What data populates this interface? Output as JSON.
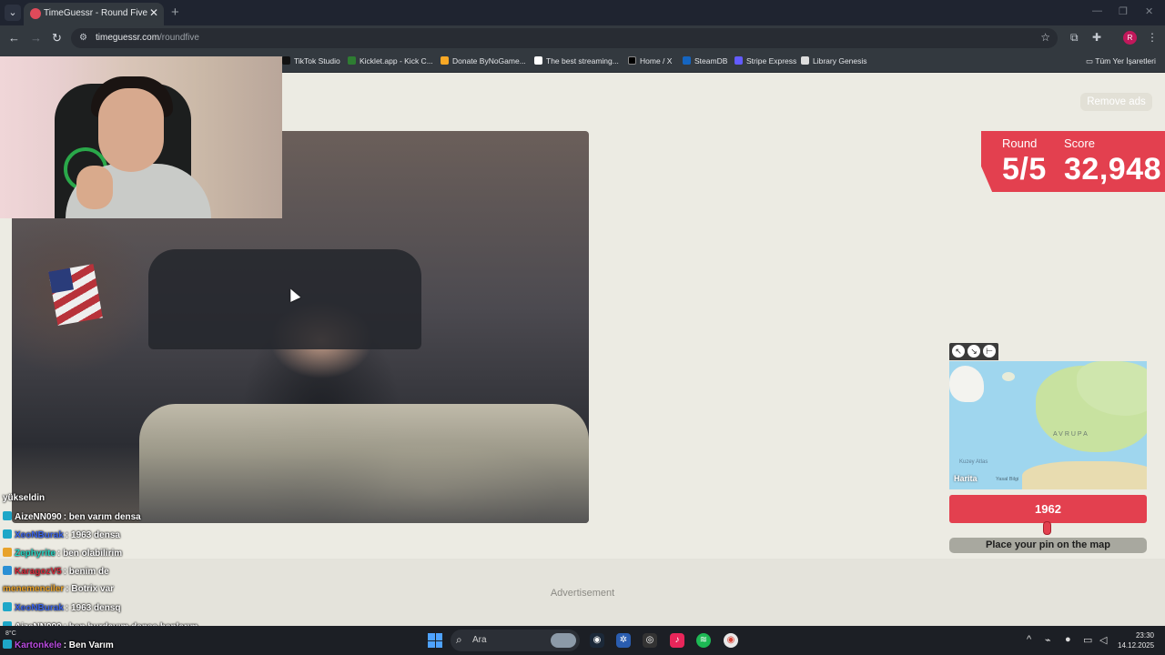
{
  "browser": {
    "tab_title": "TimeGuessr - Round Five",
    "tab_close": "✕",
    "new_tab": "+",
    "url_host": "timeguessr.com",
    "url_path": "/roundfive",
    "profile_initial": "R",
    "bookmarks": [
      {
        "label": "TikTok Studio",
        "color": "#111111"
      },
      {
        "label": "Kicklet.app - Kick C...",
        "color": "#2e7d32"
      },
      {
        "label": "Donate ByNoGame...",
        "color": "#f9a825"
      },
      {
        "label": "The best streaming...",
        "color": "#ffffff"
      },
      {
        "label": "Home / X",
        "color": "#000000"
      },
      {
        "label": "SteamDB",
        "color": "#1565c0"
      },
      {
        "label": "Stripe Express",
        "color": "#635bff"
      },
      {
        "label": "Library Genesis",
        "color": "#dddddd"
      }
    ],
    "all_bookmarks": "Tüm Yer İşaretleri"
  },
  "page": {
    "remove_ads": "Remove ads",
    "round_label": "Round",
    "round_value": "5/5",
    "score_label": "Score",
    "score_value": "32,948",
    "map_region": "AVRUPA",
    "map_sea": "Kuzey Atlas",
    "map_brand": "Harita",
    "map_legal": "Yasal Bilgi",
    "year": "1962",
    "place_pin": "Place your pin on the map",
    "advertisement": "Advertisement",
    "accent_color": "#e3404f"
  },
  "chat": [
    {
      "user": "",
      "text": "yükseldin",
      "color": "#ffffff",
      "icon": ""
    },
    {
      "user": "AizeNN090",
      "text": ": ben varım densa",
      "color": "#ffffff",
      "icon": "#1ea7c8"
    },
    {
      "user": "XeoNBurak",
      "text": ": 1963 densa",
      "color": "#3a63e8",
      "icon": "#1ea7c8"
    },
    {
      "user": "Zephyrite",
      "text": ": ben olabilirim",
      "color": "#23d3c1",
      "icon": "#e8a22a"
    },
    {
      "user": "KaragozV5",
      "text": ": benim de",
      "color": "#d42a3a",
      "icon": "#2a8fd4"
    },
    {
      "user": "menemenciler",
      "text": ": Botrix var",
      "color": "#e8a22a",
      "icon": ""
    },
    {
      "user": "XeoNBurak",
      "text": ": 1963 densq",
      "color": "#3a63e8",
      "icon": "#1ea7c8"
    },
    {
      "user": "AizeNN090",
      "text": ": ben burdayım densa banlarım",
      "color": "#ffffff",
      "icon": "#1ea7c8"
    },
    {
      "user": "Kartonkele",
      "text": ": Ben Varım",
      "color": "#b94ce0",
      "icon": "#1ea7c8"
    }
  ],
  "taskbar": {
    "search_placeholder": "Ara",
    "time": "23:30",
    "date": "14.12.2025",
    "weather": "8°C"
  }
}
